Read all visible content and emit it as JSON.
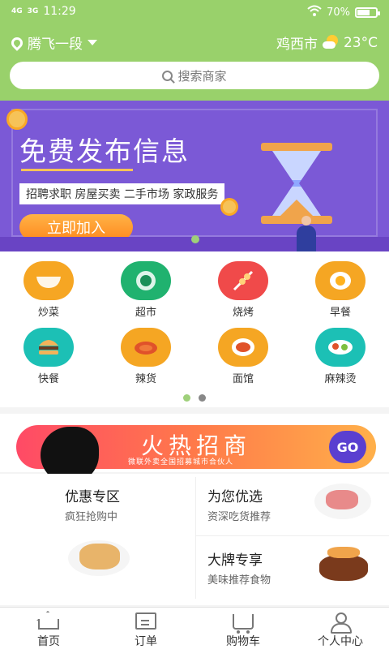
{
  "status_bar": {
    "network": "4G",
    "network2": "3G",
    "time": "11:29",
    "battery": "70%",
    "battery_level": 0.7
  },
  "location": {
    "name": "腾飞一段"
  },
  "weather": {
    "city": "鸡西市",
    "temp": "23°C"
  },
  "search": {
    "placeholder": "搜索商家"
  },
  "banner": {
    "title": "免费发布信息",
    "tags": "招聘求职  房屋买卖  二手市场  家政服务",
    "cta": "立即加入"
  },
  "categories": [
    {
      "label": "炒菜",
      "color": "#f6a623",
      "icon": "bowl-icon"
    },
    {
      "label": "超市",
      "color": "#20b26f",
      "icon": "vegetable-icon"
    },
    {
      "label": "烧烤",
      "color": "#f04a4a",
      "icon": "skewer-icon"
    },
    {
      "label": "早餐",
      "color": "#f5a623",
      "icon": "egg-icon"
    },
    {
      "label": "快餐",
      "color": "#1cc0b5",
      "icon": "burger-icon"
    },
    {
      "label": "辣货",
      "color": "#f5a623",
      "icon": "crayfish-icon"
    },
    {
      "label": "面馆",
      "color": "#f5a623",
      "icon": "noodles-icon"
    },
    {
      "label": "麻辣烫",
      "color": "#1cc0b5",
      "icon": "hotpot-icon"
    }
  ],
  "pager": {
    "active": "#9fd07a",
    "inactive": "#888888"
  },
  "promo": {
    "title": "火热招商",
    "subtitle": "微联外卖全国招募城市合伙人",
    "go": "GO"
  },
  "features": {
    "left": {
      "title": "优惠专区",
      "sub": "疯狂抢购中"
    },
    "right_top": {
      "title": "为您优选",
      "sub": "资深吃货推荐"
    },
    "right_bottom": {
      "title": "大牌专享",
      "sub": "美味推荐食物"
    }
  },
  "tabs": [
    {
      "label": "首页",
      "icon": "home-icon"
    },
    {
      "label": "订单",
      "icon": "order-icon"
    },
    {
      "label": "购物车",
      "icon": "cart-icon"
    },
    {
      "label": "个人中心",
      "icon": "user-icon"
    }
  ],
  "colors": {
    "header_green": "#99d16b",
    "banner_purple": "#7b59d6",
    "go_button": "#5a3fd0"
  }
}
